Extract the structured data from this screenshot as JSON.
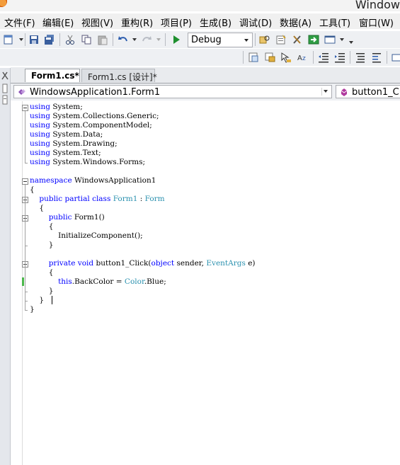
{
  "window": {
    "title": "Window"
  },
  "menu": [
    "文件(F)",
    "编辑(E)",
    "视图(V)",
    "重构(R)",
    "项目(P)",
    "生成(B)",
    "调试(D)",
    "数据(A)",
    "工具(T)",
    "窗口(W)"
  ],
  "toolbar": {
    "configuration": "Debug",
    "icons": [
      "add-new-item-icon",
      "save-icon",
      "save-all-icon",
      "cut-icon",
      "copy-icon",
      "paste-icon",
      "undo-icon",
      "redo-icon",
      "start-debugging-icon",
      "find-in-files-icon",
      "properties-icon",
      "toolbox-icon",
      "object-browser-icon",
      "command-window-icon"
    ]
  },
  "tabs": [
    {
      "label": "Form1.cs*",
      "active": true
    },
    {
      "label": "Form1.cs [设计]*",
      "active": false
    }
  ],
  "navigation": {
    "type_combo": "WindowsApplication1.Form1",
    "member_combo": "button1_Click"
  },
  "code": {
    "lines": [
      "using System;",
      "using System.Collections.Generic;",
      "using System.ComponentModel;",
      "using System.Data;",
      "using System.Drawing;",
      "using System.Text;",
      "using System.Windows.Forms;",
      "",
      "namespace WindowsApplication1",
      "{",
      "    public partial class Form1 : Form",
      "    {",
      "        public Form1()",
      "        {",
      "            InitializeComponent();",
      "        }",
      "",
      "        private void button1_Click(object sender, EventArgs e)",
      "        {",
      "            this.BackColor = Color.Blue;",
      "        }",
      "    }",
      "}"
    ],
    "keywords": [
      "using",
      "namespace",
      "public",
      "partial",
      "class",
      "private",
      "void",
      "object",
      "this"
    ],
    "types": [
      "Form1",
      "Form",
      "EventArgs",
      "Color"
    ],
    "changed_line": 20
  },
  "colors": {
    "keyword": "#0000ff",
    "type": "#2b91af",
    "change_bar": "#4cb84c",
    "toolbar_bg": "#eef0f3"
  }
}
